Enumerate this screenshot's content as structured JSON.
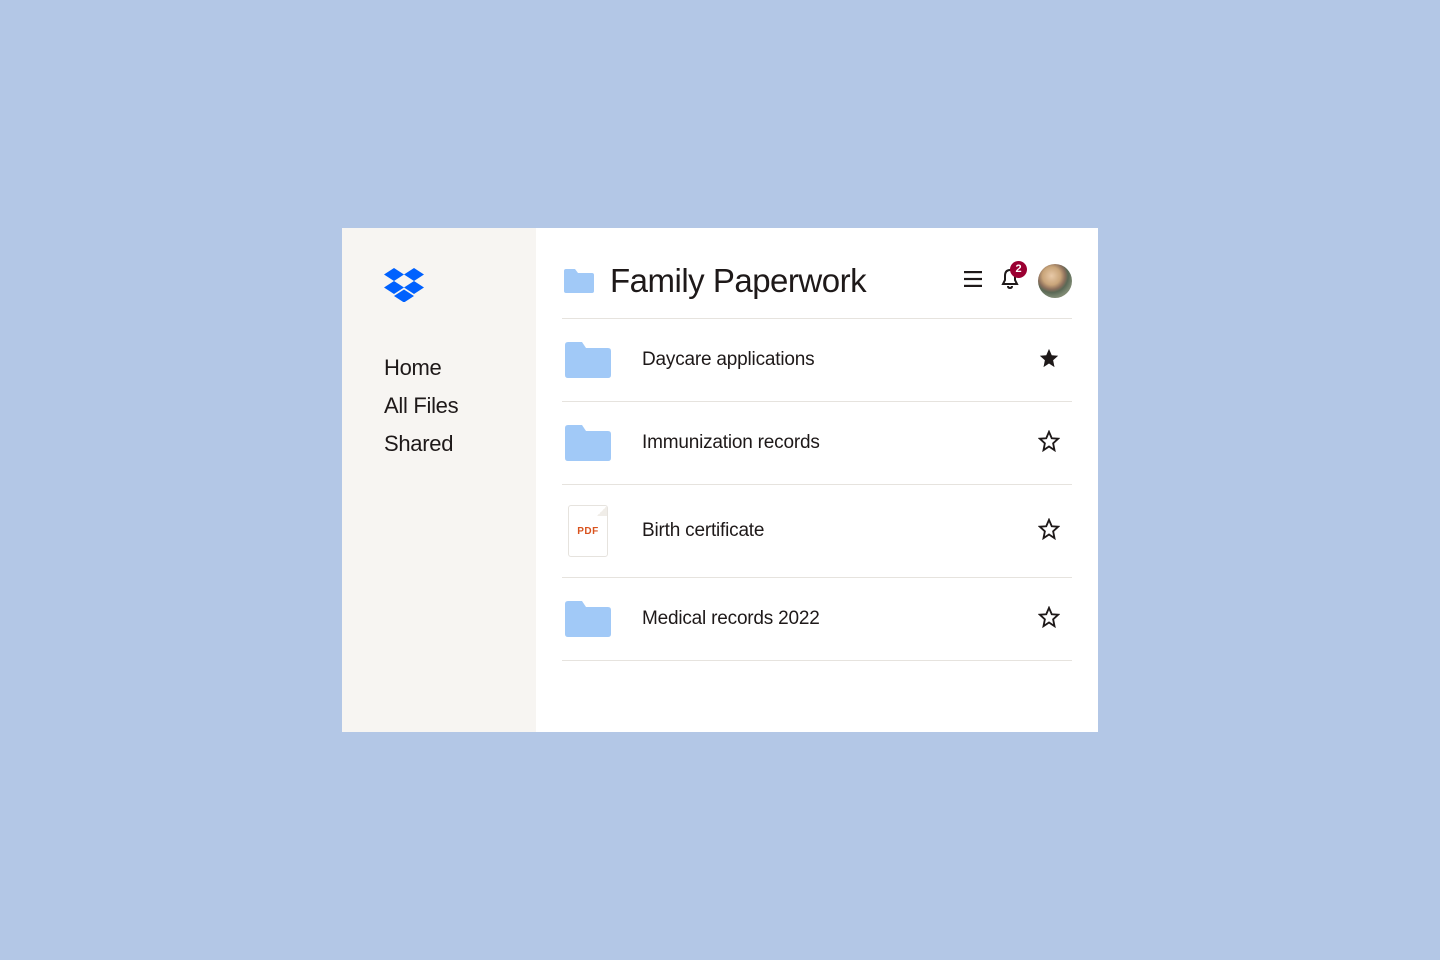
{
  "sidebar": {
    "items": [
      {
        "label": "Home"
      },
      {
        "label": "All Files"
      },
      {
        "label": "Shared"
      }
    ]
  },
  "header": {
    "title": "Family Paperwork",
    "notification_count": "2"
  },
  "files": [
    {
      "name": "Daycare applications",
      "type": "folder",
      "starred": true
    },
    {
      "name": "Immunization records",
      "type": "folder",
      "starred": false
    },
    {
      "name": "Birth certificate",
      "type": "pdf",
      "starred": false
    },
    {
      "name": "Medical records 2022",
      "type": "folder",
      "starred": false
    }
  ],
  "colors": {
    "folder_blue": "#a1c9f7",
    "brand_blue": "#0061fe",
    "badge_red": "#9b0032",
    "pdf_orange": "#d9531e"
  }
}
